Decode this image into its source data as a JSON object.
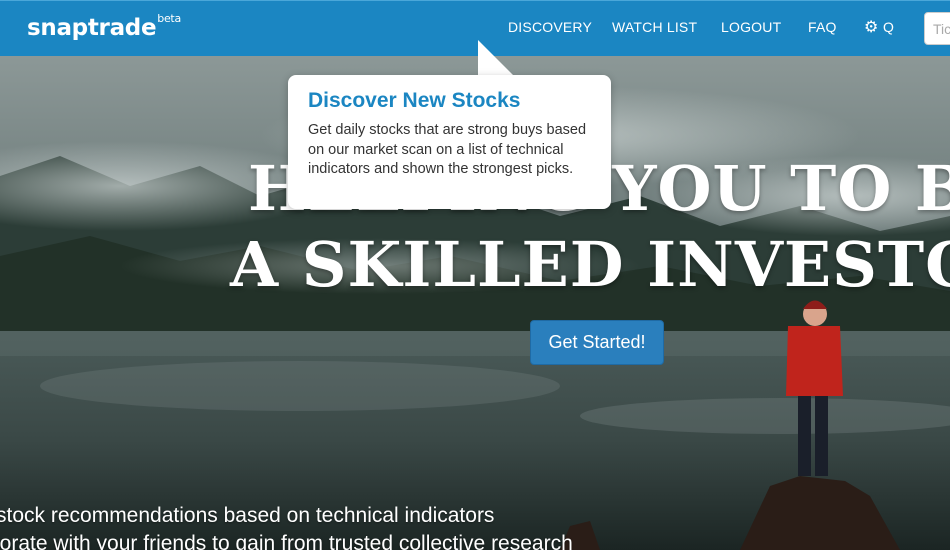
{
  "brand": {
    "name": "snaptrade",
    "badge": "beta"
  },
  "nav": {
    "discovery": "DISCOVERY",
    "watchlist": "WATCH LIST",
    "logout": "LOGOUT",
    "faq": "FAQ",
    "settings_icon": "gear-icon",
    "q_label": "Q",
    "search_placeholder": "Ticker"
  },
  "tooltip": {
    "title": "Discover New Stocks",
    "body": "Get daily stocks that are strong buys based on our market scan on a list of technical indicators and shown the strongest picks."
  },
  "hero": {
    "line1": "HELPING YOU TO BE",
    "line2": "A SKILLED INVESTOR",
    "cta": "Get Started!"
  },
  "features": [
    "stock recommendations based on technical indicators",
    "borate with your friends to gain from trusted collective research"
  ],
  "colors": {
    "navbar": "#1b86c2",
    "cta": "#2a7fbd",
    "tooltip_title": "#1b86c2"
  }
}
